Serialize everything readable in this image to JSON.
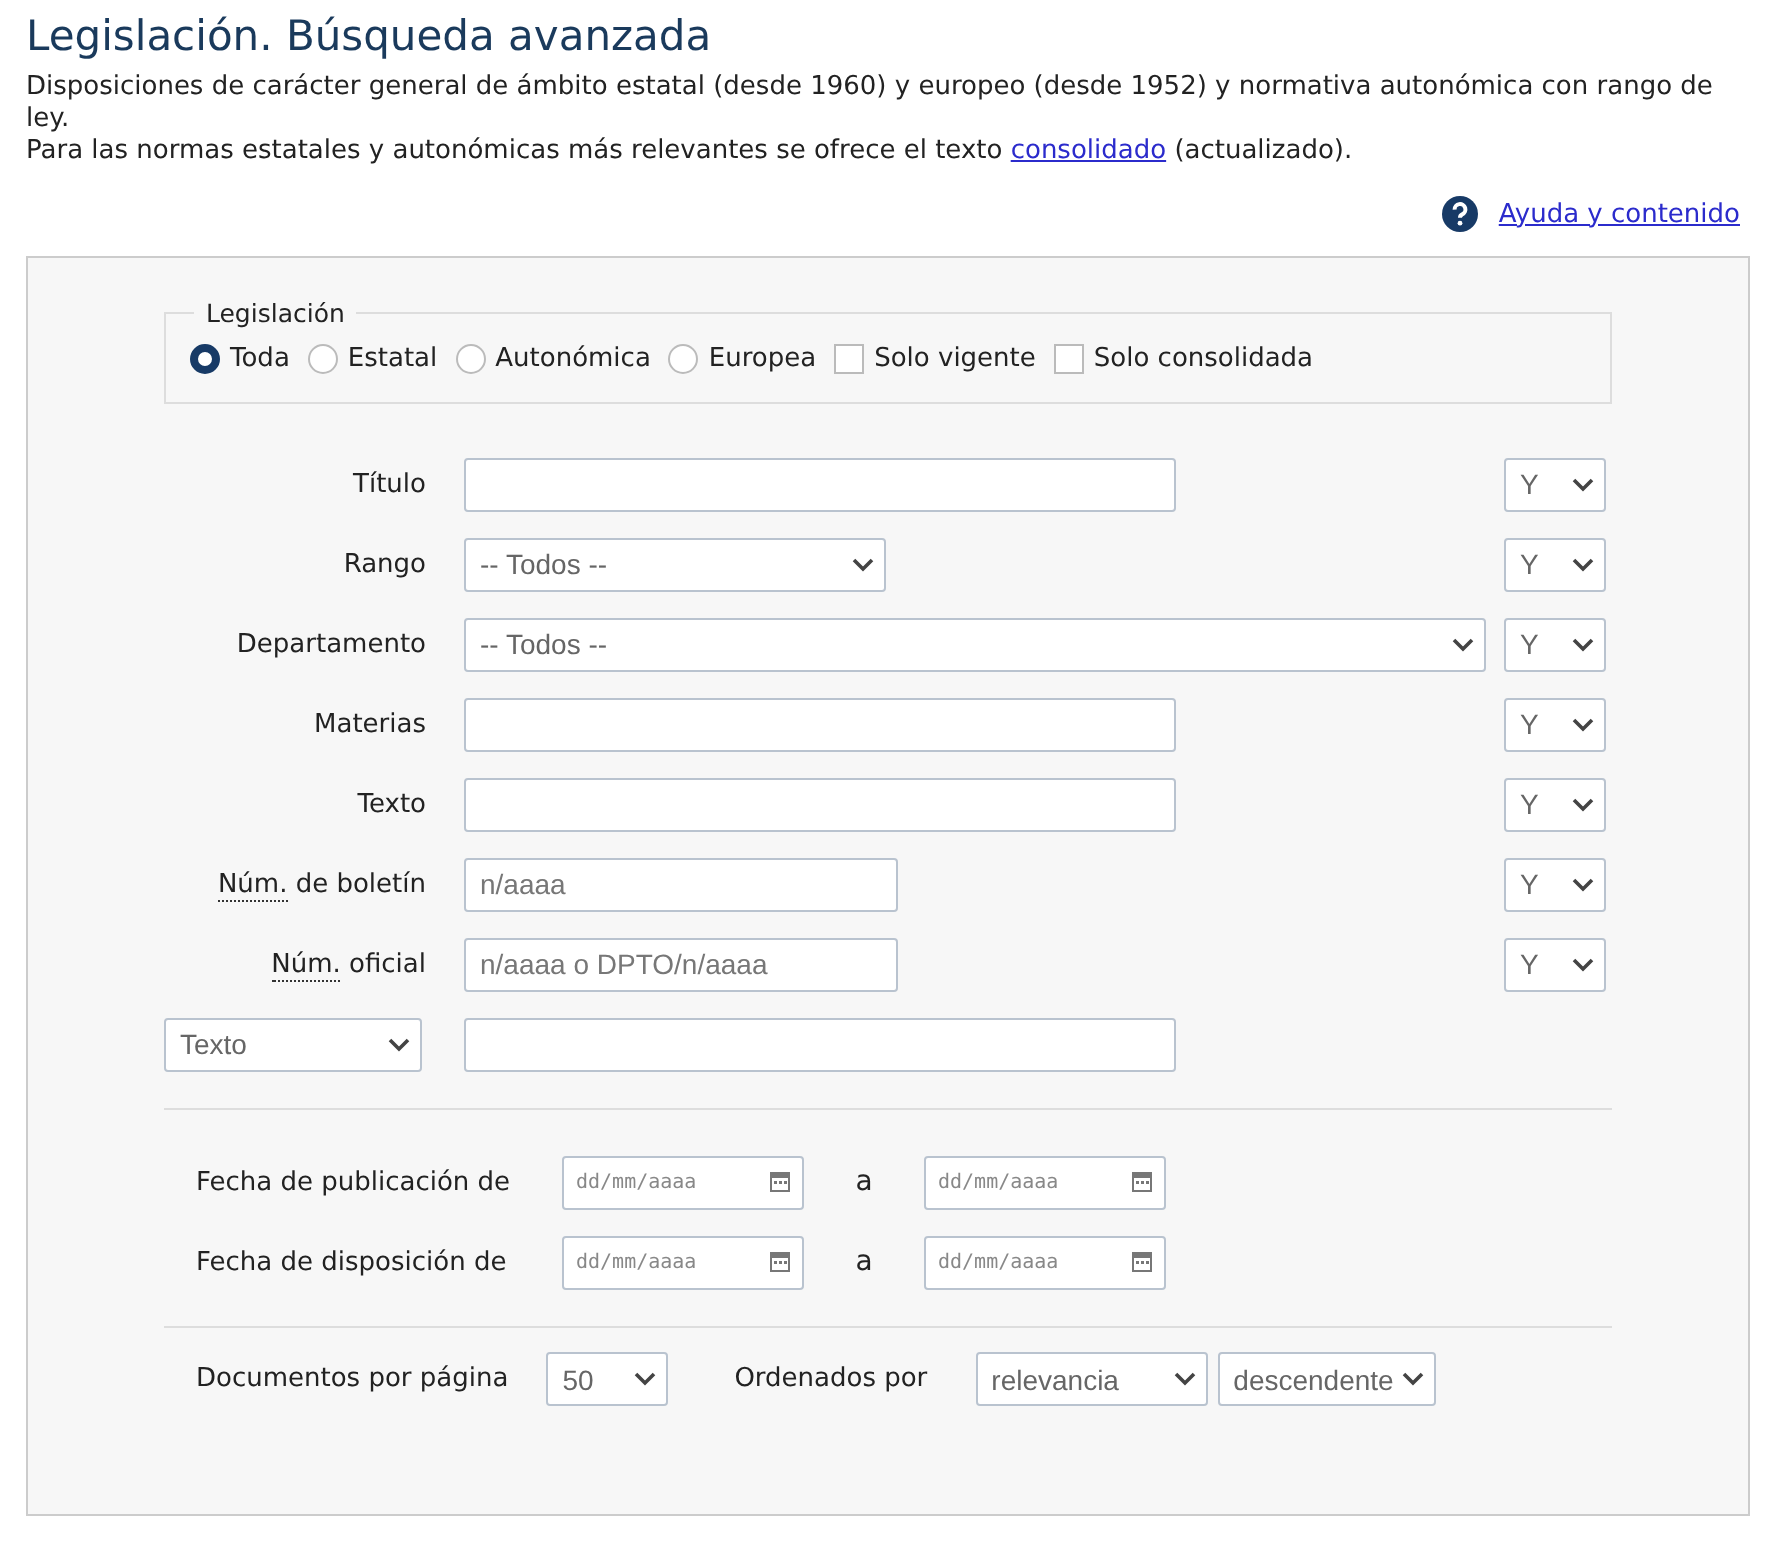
{
  "title": "Legislación. Búsqueda avanzada",
  "intro": {
    "line1": "Disposiciones de carácter general de ámbito estatal (desde 1960) y europeo (desde 1952) y normativa autonómica con rango de ley.",
    "line2_before": "Para las normas estatales y autonómicas más relevantes se ofrece el texto ",
    "line2_link": "consolidado",
    "line2_after": " (actualizado)."
  },
  "help_link": "Ayuda y contenido",
  "legislation": {
    "legend": "Legislación",
    "options": [
      {
        "kind": "radio",
        "label": "Toda",
        "selected": true
      },
      {
        "kind": "radio",
        "label": "Estatal",
        "selected": false
      },
      {
        "kind": "radio",
        "label": "Autonómica",
        "selected": false
      },
      {
        "kind": "radio",
        "label": "Europea",
        "selected": false
      },
      {
        "kind": "checkbox",
        "label": "Solo vigente",
        "checked": false
      },
      {
        "kind": "checkbox",
        "label": "Solo consolidada",
        "checked": false
      }
    ]
  },
  "fields": [
    {
      "kind": "input",
      "label": "Título",
      "operator": "Y"
    },
    {
      "kind": "select",
      "label": "Rango",
      "value": "-- Todos --",
      "operator": "Y"
    },
    {
      "kind": "wide_select",
      "label": "Departamento",
      "value": "-- Todos --",
      "operator": "Y"
    },
    {
      "kind": "input",
      "label": "Materias",
      "operator": "Y"
    },
    {
      "kind": "input",
      "label": "Texto",
      "operator": "Y"
    },
    {
      "kind": "short_input",
      "abbr": "Núm.",
      "label": "de boletín",
      "placeholder": "n/aaaa",
      "operator": "Y"
    },
    {
      "kind": "short_input",
      "abbr": "Núm.",
      "label": "oficial",
      "placeholder": "n/aaaa o DPTO/n/aaaa",
      "operator": "Y"
    },
    {
      "kind": "selector_input",
      "selector": "Texto"
    }
  ],
  "dates": [
    {
      "label": "Fecha de publicación de",
      "from_placeholder": "dd/mm/aaaa",
      "separator": "a",
      "to_placeholder": "dd/mm/aaaa"
    },
    {
      "label": "Fecha de disposición de",
      "from_placeholder": "dd/mm/aaaa",
      "separator": "a",
      "to_placeholder": "dd/mm/aaaa"
    }
  ],
  "footer": {
    "per_page_label": "Documentos por página",
    "per_page": "50",
    "order_label": "Ordenados por",
    "order_by": "relevancia",
    "direction": "descendente"
  }
}
